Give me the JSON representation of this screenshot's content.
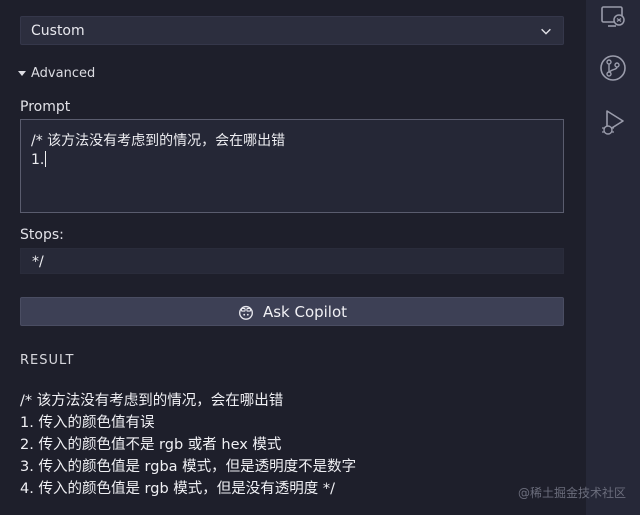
{
  "model_select": {
    "value": "Custom"
  },
  "advanced": {
    "label": "Advanced"
  },
  "prompt": {
    "label": "Prompt",
    "lines": [
      "/* 该方法没有考虑到的情况，会在哪出错",
      "1."
    ]
  },
  "stops": {
    "label": "Stops:",
    "value": "*/"
  },
  "ask_button": {
    "label": "Ask Copilot",
    "icon": "copilot-icon"
  },
  "result": {
    "heading": "RESULT",
    "lines": [
      "/* 该方法没有考虑到的情况，会在哪出错",
      "1. 传入的颜色值有误",
      "2. 传入的颜色值不是 rgb 或者 hex 模式",
      "3. 传入的颜色值是 rgba 模式，但是透明度不是数字",
      "4. 传入的颜色值是 rgb 模式，但是没有透明度 */"
    ]
  },
  "activity_bar": {
    "icons": [
      "remote-explorer-icon",
      "source-control-icon",
      "run-debug-icon"
    ]
  },
  "watermark": "@稀土掘金技术社区"
}
